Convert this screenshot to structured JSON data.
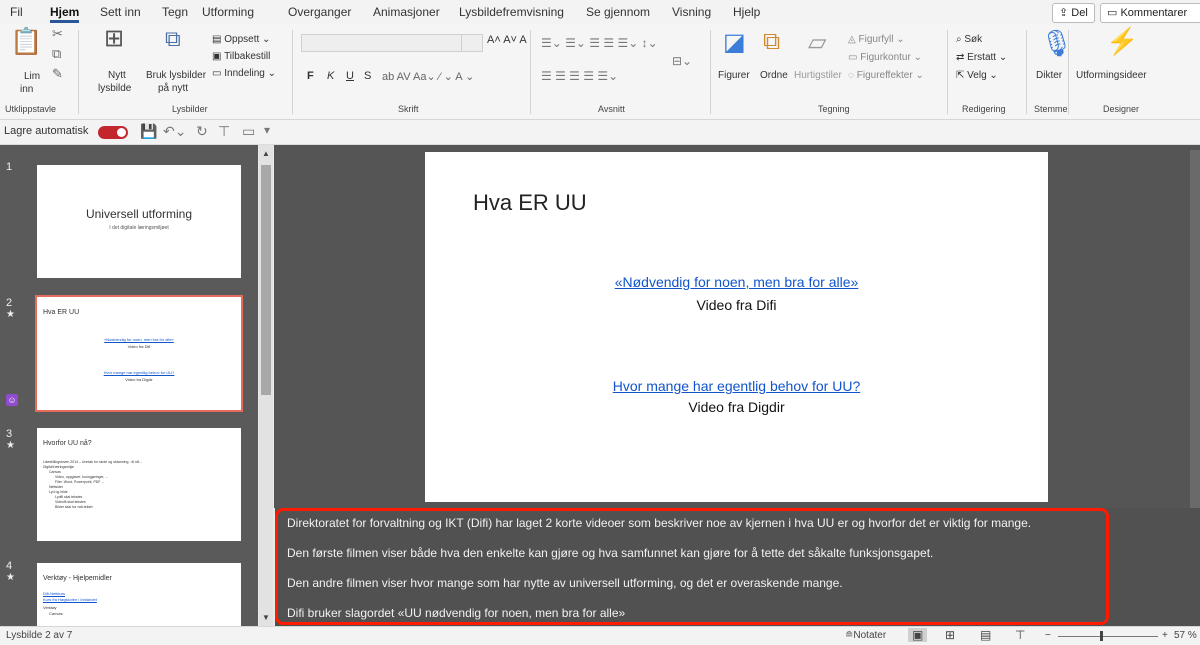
{
  "menu": {
    "tabs": [
      "Fil",
      "Hjem",
      "Sett inn",
      "Tegn",
      "Utforming",
      "Overganger",
      "Animasjoner",
      "Lysbildefremvisning",
      "Se gjennom",
      "Visning",
      "Hjelp"
    ],
    "share": "Del",
    "comments": "Kommentarer"
  },
  "ribbon": {
    "clipboard": {
      "paste": "Lim",
      "paste2": "inn",
      "label": "Utklippstavle"
    },
    "slides": {
      "new1": "Nytt",
      "new2": "lysbilde",
      "reuse1": "Bruk lysbilder",
      "reuse2": "på nytt",
      "layout": "Oppsett",
      "reset": "Tilbakestill",
      "section": "Inndeling",
      "label": "Lysbilder"
    },
    "font": {
      "bold": "F",
      "italic": "K",
      "underline": "U",
      "strike": "S",
      "label": "Skrift"
    },
    "paragraph": {
      "label": "Avsnitt"
    },
    "drawing": {
      "shapes": "Figurer",
      "arrange": "Ordne",
      "quick": "Hurtigstiler",
      "fill": "Figurfyll",
      "outline": "Figurkontur",
      "effects": "Figureffekter",
      "label": "Tegning"
    },
    "editing": {
      "find": "Søk",
      "replace": "Erstatt",
      "select": "Velg",
      "label": "Redigering"
    },
    "voice": {
      "dictate": "Dikter",
      "label": "Stemme"
    },
    "designer": {
      "ideas": "Utformingsideer",
      "label": "Designer"
    }
  },
  "qat": {
    "autosave": "Lagre automatisk"
  },
  "thumbnails": [
    {
      "num": "1",
      "title": "Universell utforming",
      "subtitle": "I det digitale læringsmiljøet"
    },
    {
      "num": "2",
      "star": "★",
      "title": "Hva ER UU",
      "link1": "«Nødvendig for noen, men bra for alle»",
      "sub1": "Video fra Difi",
      "link2": "Hvor mange har egentlig behov for UU?",
      "sub2": "Video fra Digdir"
    },
    {
      "num": "3",
      "star": "★",
      "title": "Hvorfor UU nå?",
      "b1": "Likestillingsloven 2014 – Unntak for skole og utdanning - til nå...",
      "b2": "Digitalt læringsmiljø:",
      "b3": "Canvas",
      "b4": "Video, oppgaver, kunngjøringer, ...",
      "b5": "Filer: Word, Powerpoint, PDF ...",
      "b6": "Nettsider",
      "b7": "Lyd og bilde",
      "b8": "Lydfil skal tekstes",
      "b9": "Videofil skal tekstes",
      "b10": "Bilder skal ha «alt-tekst»"
    },
    {
      "num": "4",
      "star": "★",
      "title": "Verktøy - Hjelpemidler",
      "b1": "Difi-Nettkurs",
      "b2": "Kurs fra Høgskolen i Innlandet",
      "b3": "Verktøy",
      "b4": "Canvas"
    }
  ],
  "slide": {
    "title": "Hva ER UU",
    "link1": "«Nødvendig for noen, men bra for alle»",
    "sub1": "Video fra Difi",
    "link2": "Hvor mange har egentlig behov for UU?",
    "sub2": "Video fra Digdir"
  },
  "notes": [
    "Direktoratet for forvaltning og IKT (Difi) har laget 2 korte videoer som beskriver noe av kjernen i hva UU er og hvorfor det er viktig for mange.",
    "Den første filmen viser både hva den enkelte kan gjøre og hva samfunnet kan gjøre for å tette det såkalte funksjonsgapet.",
    "Den andre filmen viser hvor mange som har nytte av universell utforming, og det er overaskende mange.",
    "Difi bruker slagordet  «UU nødvendig for noen, men bra for alle»"
  ],
  "status": {
    "slide": "Lysbilde 2 av 7",
    "notes": "Notater",
    "zoom": "57 %"
  }
}
